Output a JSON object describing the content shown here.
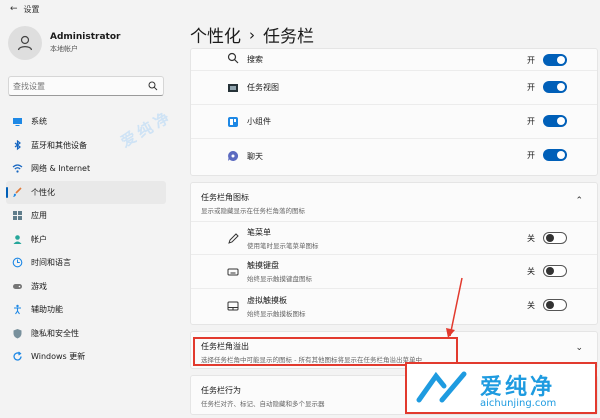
{
  "window": {
    "title": "设置"
  },
  "profile": {
    "name": "Administrator",
    "subtitle": "本地帐户"
  },
  "search": {
    "placeholder": "查找设置"
  },
  "sidebar": {
    "items": [
      {
        "label": "系统",
        "icon": "monitor-icon"
      },
      {
        "label": "蓝牙和其他设备",
        "icon": "bluetooth-icon"
      },
      {
        "label": "网络 & Internet",
        "icon": "wifi-icon"
      },
      {
        "label": "个性化",
        "icon": "brush-icon",
        "active": true
      },
      {
        "label": "应用",
        "icon": "apps-icon"
      },
      {
        "label": "帐户",
        "icon": "person-icon"
      },
      {
        "label": "时间和语言",
        "icon": "globe-clock-icon"
      },
      {
        "label": "游戏",
        "icon": "gamepad-icon"
      },
      {
        "label": "辅助功能",
        "icon": "accessibility-icon"
      },
      {
        "label": "隐私和安全性",
        "icon": "shield-icon"
      },
      {
        "label": "Windows 更新",
        "icon": "update-icon"
      }
    ]
  },
  "header": {
    "parent": "个性化",
    "separator": "›",
    "current": "任务栏"
  },
  "taskbar_items": [
    {
      "label": "搜索",
      "state": "开",
      "on": true,
      "icon": "search-icon"
    },
    {
      "label": "任务视图",
      "state": "开",
      "on": true,
      "icon": "task-view-icon"
    },
    {
      "label": "小组件",
      "state": "开",
      "on": true,
      "icon": "widgets-icon"
    },
    {
      "label": "聊天",
      "state": "开",
      "on": true,
      "icon": "chat-icon"
    }
  ],
  "corner_icons": {
    "title": "任务栏角图标",
    "description": "显示或隐藏显示在任务栏角落的图标",
    "items": [
      {
        "label": "笔菜单",
        "description": "使用笔时显示笔菜单图标",
        "state": "关",
        "on": false,
        "icon": "pen-icon"
      },
      {
        "label": "触摸键盘",
        "description": "始终显示触摸键盘图标",
        "state": "关",
        "on": false,
        "icon": "keyboard-icon"
      },
      {
        "label": "虚拟触摸板",
        "description": "始终显示触摸板图标",
        "state": "关",
        "on": false,
        "icon": "touchpad-icon"
      }
    ]
  },
  "overflow": {
    "title": "任务栏角溢出",
    "description": "选择任务栏角中可能显示的图标 - 所有其他图标将显示在任务栏角溢出菜单中"
  },
  "behavior": {
    "title": "任务栏行为",
    "description": "任务栏对齐、标记、自动隐藏和多个显示器"
  },
  "watermark": {
    "name": "爱纯净",
    "url": "aichunjing.com"
  },
  "colors": {
    "accent": "#005fb8",
    "highlight": "#e23a2e",
    "watermark": "#1e9be0"
  }
}
